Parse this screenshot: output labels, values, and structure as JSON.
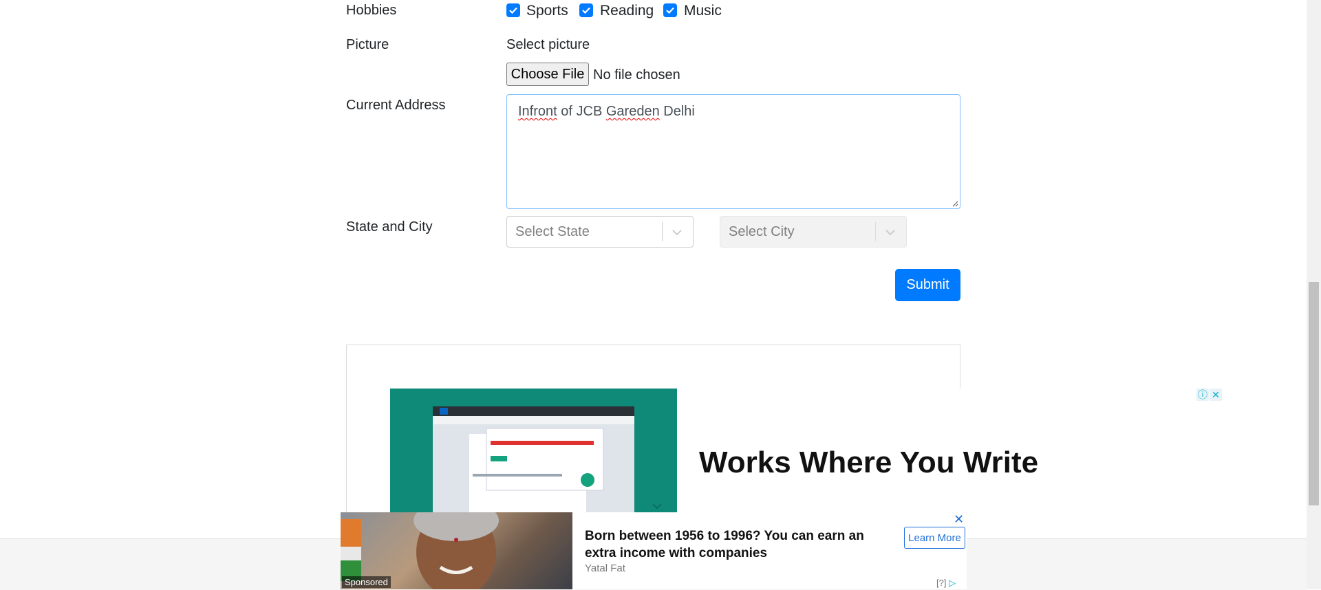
{
  "form": {
    "hobbies": {
      "label": "Hobbies",
      "options": [
        {
          "label": "Sports",
          "checked": true
        },
        {
          "label": "Reading",
          "checked": true
        },
        {
          "label": "Music",
          "checked": true
        }
      ]
    },
    "picture": {
      "label": "Picture",
      "hint": "Select picture",
      "button_label": "Choose File",
      "file_status": "No file chosen"
    },
    "address": {
      "label": "Current Address",
      "value_parts": [
        "Infront",
        " of ",
        "JCB",
        " ",
        "Gareden",
        " Delhi"
      ]
    },
    "state_city": {
      "label": "State and City",
      "state_placeholder": "Select State",
      "city_placeholder": "Select City"
    },
    "submit_label": "Submit"
  },
  "ad_main": {
    "headline": "Works Where You Write",
    "icons": [
      "info-icon",
      "close-icon"
    ]
  },
  "ad_bottom": {
    "sponsored": "Sponsored",
    "title": "Born between 1956 to 1996? You can earn an extra income with companies",
    "source": "Yatal Fat",
    "button_label": "Learn More",
    "help": "[?]"
  },
  "colors": {
    "primary": "#007bff",
    "ad_teal": "#0f8a78"
  }
}
